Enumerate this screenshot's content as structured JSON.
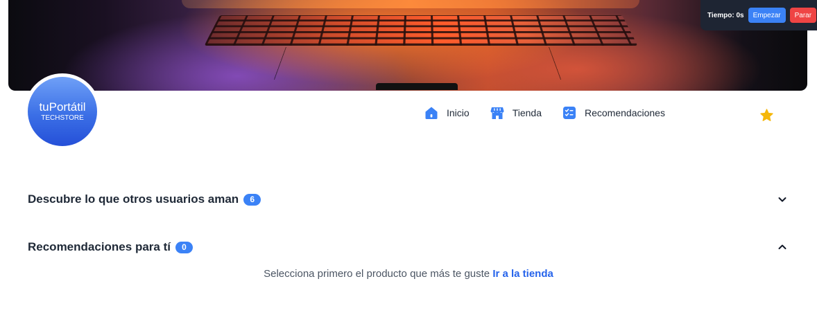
{
  "timer": {
    "label": "Tiempo: 0s",
    "start_label": "Empezar",
    "stop_label": "Parar"
  },
  "brand": {
    "name": "tuPortátil",
    "tagline": "TECHSTORE"
  },
  "nav": {
    "items": [
      {
        "label": "Inicio",
        "icon": "home-icon"
      },
      {
        "label": "Tienda",
        "icon": "store-icon"
      },
      {
        "label": "Recomendaciones",
        "icon": "checklist-icon"
      }
    ],
    "favorites_icon": "star-icon"
  },
  "sections": [
    {
      "title": "Descubre lo que otros usuarios aman",
      "count": "6",
      "state": "collapsed"
    },
    {
      "title": "Recomendaciones para tí",
      "count": "0",
      "state": "expanded"
    }
  ],
  "recommendations_empty": {
    "message": "Selecciona primero el producto que más te guste",
    "link_label": "Ir a la tienda"
  },
  "colors": {
    "accent": "#3b82f6",
    "danger": "#ef4444",
    "star": "#f5b70a",
    "timer_bg": "#1e2533"
  }
}
